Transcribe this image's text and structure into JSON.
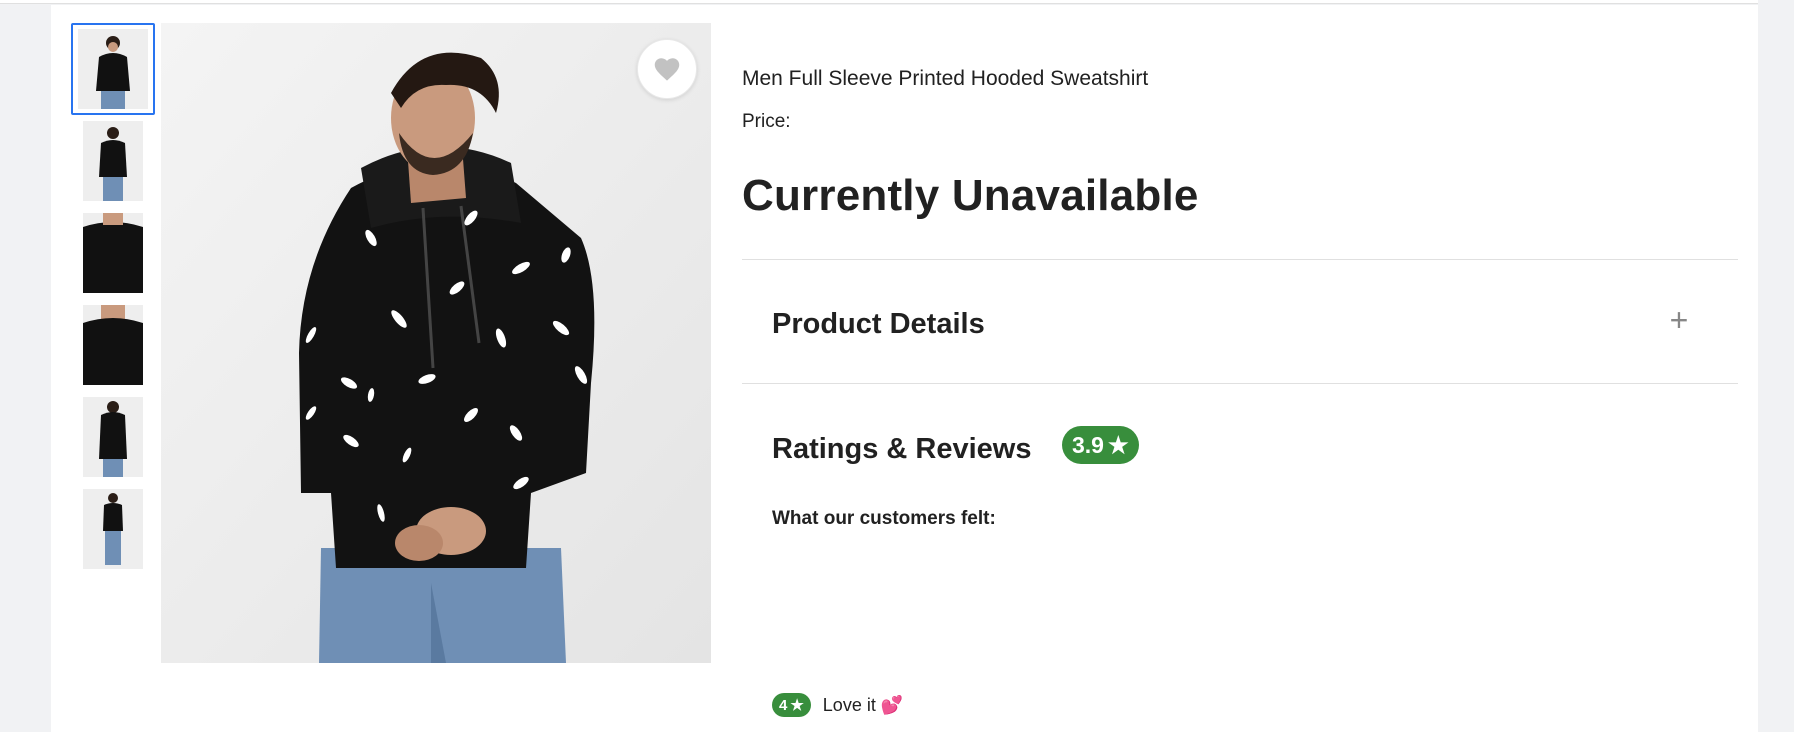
{
  "product": {
    "title": "Men Full Sleeve Printed Hooded Sweatshirt",
    "price_label": "Price:",
    "availability": "Currently Unavailable"
  },
  "gallery": {
    "thumbnail_count": 6,
    "active_index": 0,
    "wishlist_icon": "heart-icon"
  },
  "sections": {
    "details_title": "Product Details",
    "details_toggle": "+",
    "ratings_title": "Ratings & Reviews",
    "ratings_value": "3.9",
    "star": "★",
    "customers_felt": "What our customers felt:"
  },
  "review": {
    "rating": "4",
    "star": "★",
    "text": "Love it",
    "emoji": "💕"
  },
  "colors": {
    "accent_blue": "#2874f0",
    "rating_green": "#388e3c"
  }
}
